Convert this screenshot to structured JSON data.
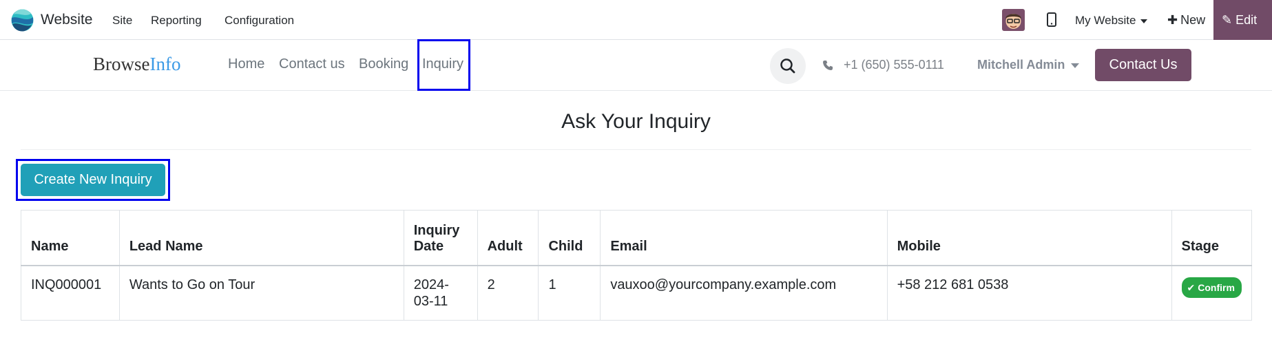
{
  "topbar": {
    "app_name": "Website",
    "menu": [
      "Site",
      "Reporting",
      "Configuration"
    ],
    "website_switcher": "My Website",
    "new_label": "New",
    "edit_label": "Edit"
  },
  "header": {
    "brand_part1": "Browse",
    "brand_part2": "Info",
    "nav": [
      "Home",
      "Contact us",
      "Booking",
      "Inquiry"
    ],
    "phone": "+1 (650) 555-0111",
    "user": "Mitchell Admin",
    "contact_button": "Contact Us"
  },
  "main": {
    "title": "Ask Your Inquiry",
    "create_button": "Create New Inquiry",
    "table": {
      "columns": [
        "Name",
        "Lead Name",
        "Inquiry Date",
        "Adult",
        "Child",
        "Email",
        "Mobile",
        "Stage"
      ],
      "rows": [
        {
          "name": "INQ000001",
          "lead_name": "Wants to Go on Tour",
          "date": "2024-03-11",
          "adult": "2",
          "child": "1",
          "email": "vauxoo@yourcompany.example.com",
          "mobile": "+58 212 681 0538",
          "stage": "Confirm"
        }
      ]
    }
  },
  "colors": {
    "odoo_purple": "#714b67",
    "create_button": "#20a0b8",
    "stage_badge": "#28a745",
    "highlight_box": "#0000ee",
    "brand_info": "#3b9ae6"
  }
}
